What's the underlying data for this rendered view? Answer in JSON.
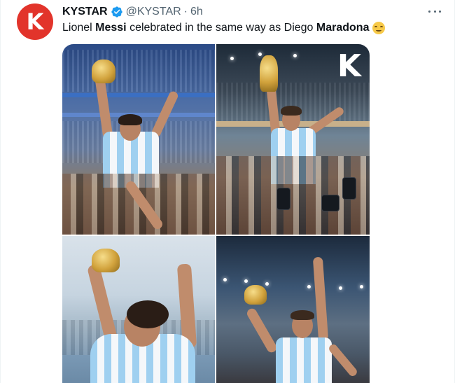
{
  "tweet": {
    "avatar_letter": "K",
    "author_name": "KYSTAR",
    "handle": "@KYSTAR",
    "separator": "·",
    "time": "6h",
    "verified": true,
    "text_parts": [
      {
        "text": "Lionel ",
        "bold": false
      },
      {
        "text": "Messi",
        "bold": true
      },
      {
        "text": " celebrated in the same way as Diego ",
        "bold": false
      },
      {
        "text": "Maradona",
        "bold": true
      }
    ],
    "emoji": "smiling-face-emoji",
    "media_mark": "K"
  },
  "colors": {
    "brand_red": "#e2342b",
    "verified_blue": "#1d9bf0",
    "secondary_text": "#536471"
  },
  "icons": {
    "verified": "verified-badge-icon",
    "more": "more-options-icon"
  }
}
